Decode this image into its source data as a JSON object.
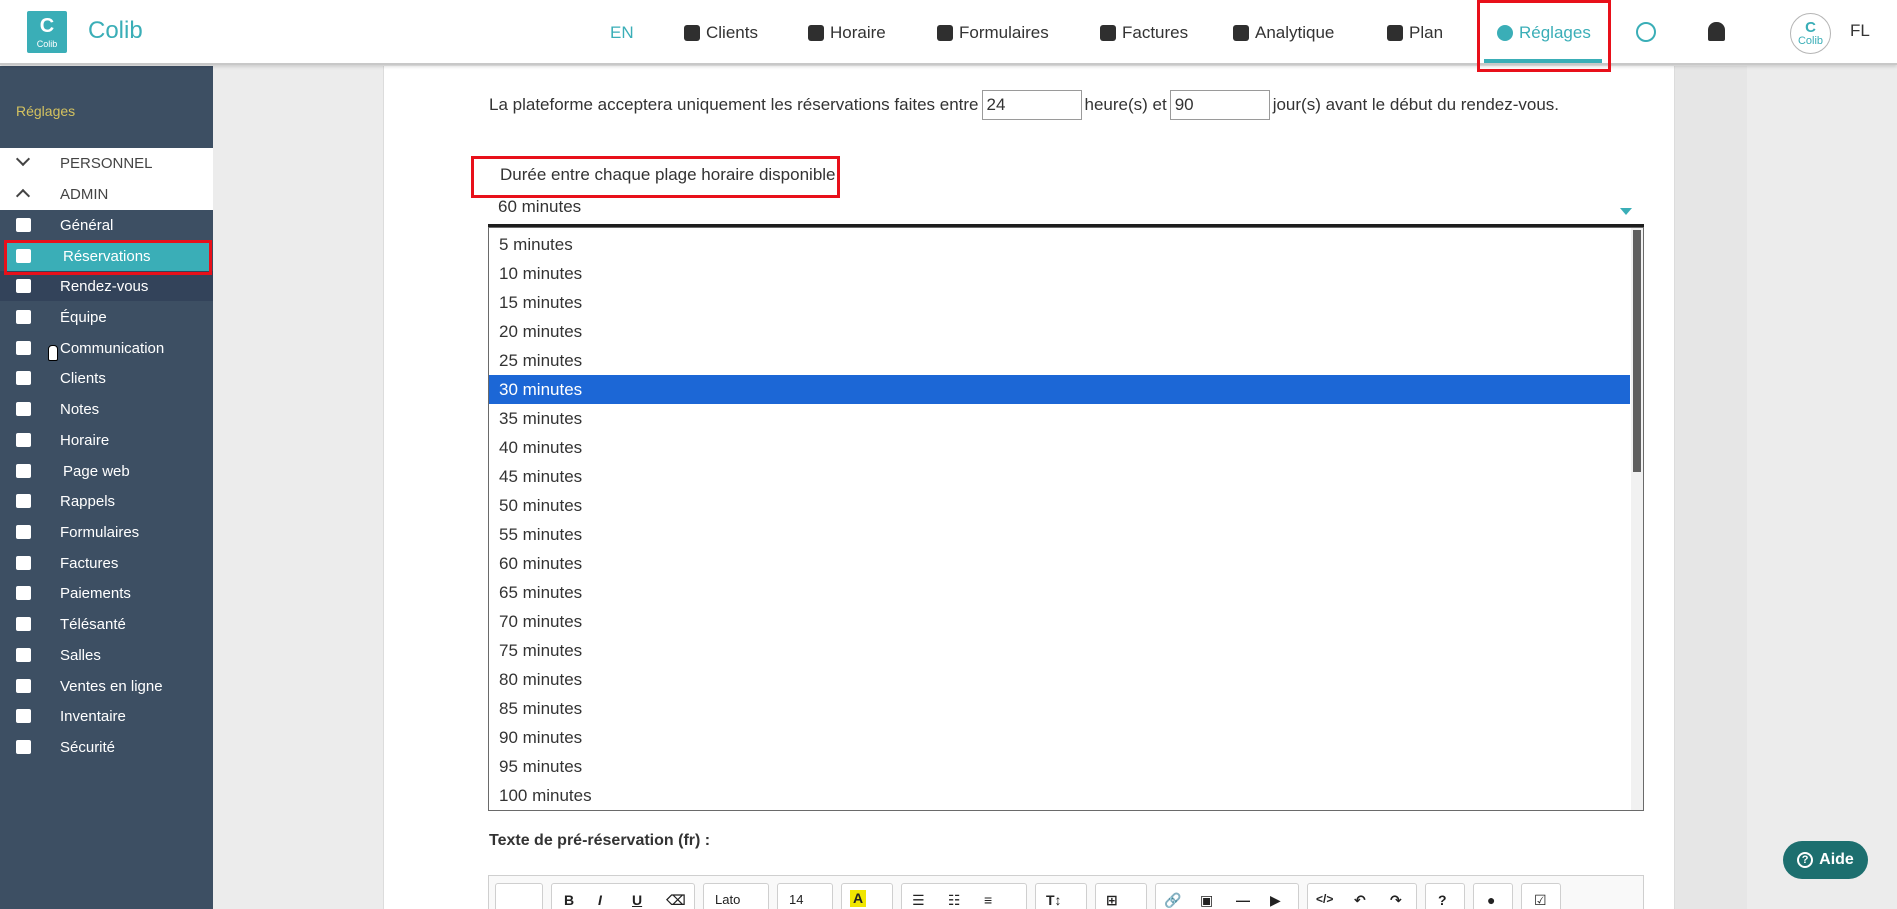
{
  "brand": {
    "name": "Colib",
    "logo_text": "Colib"
  },
  "nav": {
    "lang": "EN",
    "items": [
      {
        "label": "Clients",
        "icon": "user-icon"
      },
      {
        "label": "Horaire",
        "icon": "calendar-icon"
      },
      {
        "label": "Formulaires",
        "icon": "form-edit-icon"
      },
      {
        "label": "Factures",
        "icon": "invoice-icon"
      },
      {
        "label": "Analytique",
        "icon": "chart-icon"
      },
      {
        "label": "Plan",
        "icon": "credit-card-icon"
      },
      {
        "label": "Réglages",
        "icon": "gear-icon",
        "active": true
      }
    ],
    "user_initials": "FL"
  },
  "sidebar": {
    "heading": "Réglages",
    "categories": [
      {
        "label": "PERSONNEL",
        "state": "collapsed"
      },
      {
        "label": "ADMIN",
        "state": "expanded"
      }
    ],
    "items": [
      {
        "label": "Général",
        "icon": "gear-icon"
      },
      {
        "label": "Réservations",
        "icon": "clipboard-icon",
        "selected": true
      },
      {
        "label": "Rendez-vous",
        "icon": "contact-book-icon"
      },
      {
        "label": "Équipe",
        "icon": "users-icon"
      },
      {
        "label": "Communication",
        "icon": "chat-icon"
      },
      {
        "label": "Clients",
        "icon": "user-icon"
      },
      {
        "label": "Notes",
        "icon": "note-icon"
      },
      {
        "label": "Horaire",
        "icon": "calendar-icon"
      },
      {
        "label": "Page web",
        "icon": "globe-icon"
      },
      {
        "label": "Rappels",
        "icon": "stopwatch-icon"
      },
      {
        "label": "Formulaires",
        "icon": "form-edit-icon"
      },
      {
        "label": "Factures",
        "icon": "invoice-icon"
      },
      {
        "label": "Paiements",
        "icon": "credit-card-icon"
      },
      {
        "label": "Télésanté",
        "icon": "video-icon"
      },
      {
        "label": "Salles",
        "icon": "door-icon"
      },
      {
        "label": "Ventes en ligne",
        "icon": "cart-icon"
      },
      {
        "label": "Inventaire",
        "icon": "list-icon"
      },
      {
        "label": "Sécurité",
        "icon": "shield-icon"
      }
    ]
  },
  "booking": {
    "sentence_prefix": "La plateforme acceptera uniquement les réservations faites entre",
    "hours_value": "24",
    "sentence_mid": "heure(s) et",
    "days_value": "90",
    "sentence_suffix": "jour(s) avant le début du rendez-vous."
  },
  "duration": {
    "label": "Durée entre chaque plage horaire disponible",
    "selected_value": "60 minutes",
    "highlighted_option": "30 minutes",
    "options": [
      "5 minutes",
      "10 minutes",
      "15 minutes",
      "20 minutes",
      "25 minutes",
      "30 minutes",
      "35 minutes",
      "40 minutes",
      "45 minutes",
      "50 minutes",
      "55 minutes",
      "60 minutes",
      "65 minutes",
      "70 minutes",
      "75 minutes",
      "80 minutes",
      "85 minutes",
      "90 minutes",
      "95 minutes",
      "100 minutes"
    ]
  },
  "pre_reservation": {
    "label": "Texte de pré-réservation (fr) :",
    "toolbar": {
      "font_name": "Lato",
      "font_size": "14",
      "buttons": [
        "magic-icon",
        "bold-icon",
        "italic-icon",
        "underline-icon",
        "eraser-icon",
        "highlight-icon",
        "bullet-list-icon",
        "numbered-list-icon",
        "align-icon",
        "text-height-icon",
        "table-icon",
        "link-icon",
        "image-icon",
        "horizontal-rule-icon",
        "video-icon",
        "code-icon",
        "undo-icon",
        "redo-icon",
        "help-icon",
        "microphone-icon",
        "check-icon"
      ]
    }
  },
  "help": {
    "label": "Aide"
  },
  "colors": {
    "accent": "#3aaeb7",
    "sidebar_bg": "#3d4f63",
    "sidebar_heading": "#d4c25f",
    "highlight_red": "#e8101a",
    "select_blue": "#1c67d6"
  }
}
